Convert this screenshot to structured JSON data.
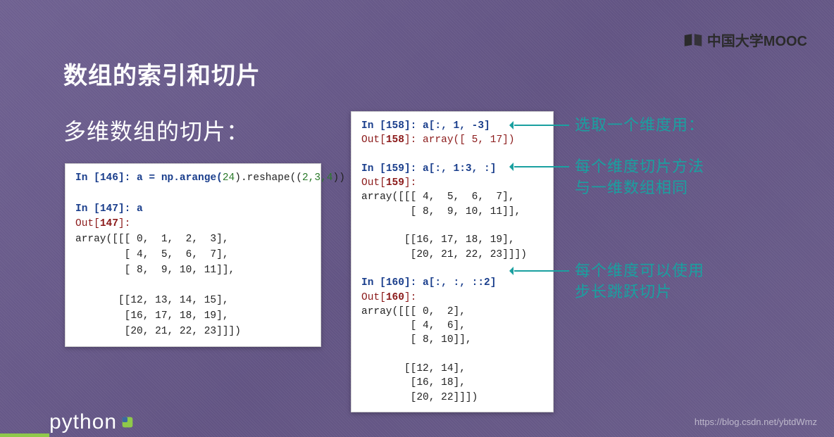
{
  "brand": "中国大学MOOC",
  "heading": "数组的索引和切片",
  "subheading": "多维数组的切片：",
  "annotations": {
    "a1": "选取一个维度用：",
    "a2": "每个维度切片方法\n与一维数组相同",
    "a3": "每个维度可以使用\n步长跳跃切片"
  },
  "left_block": {
    "in146_label": "In [",
    "in146_num": "146",
    "in146_tail": "]: a = np.arange(",
    "in146_arg": "24",
    "in146_tail2": ").reshape((",
    "in146_dims": "2,3,4",
    "in146_tail3": "))",
    "in147_label": "In [",
    "in147_num": "147",
    "in147_tail": "]: a",
    "out147_label": "Out[",
    "out147_num": "147",
    "out147_tail": "]:",
    "array_text": "array([[[ 0,  1,  2,  3],\n        [ 4,  5,  6,  7],\n        [ 8,  9, 10, 11]],\n\n       [[12, 13, 14, 15],\n        [16, 17, 18, 19],\n        [20, 21, 22, 23]]])"
  },
  "right_block": {
    "in158_num": "158",
    "in158_code": "]: a[:, 1, -3]",
    "out158_num": "158",
    "out158_val": "]: array([ 5, 17])",
    "in159_num": "159",
    "in159_code": "]: a[:, 1:3, :]",
    "out159_num": "159",
    "out159_tail": "]:",
    "arr159": "array([[[ 4,  5,  6,  7],\n        [ 8,  9, 10, 11]],\n\n       [[16, 17, 18, 19],\n        [20, 21, 22, 23]]])",
    "in160_num": "160",
    "in160_code": "]: a[:, :, ::2]",
    "out160_num": "160",
    "out160_tail": "]:",
    "arr160": "array([[[ 0,  2],\n        [ 4,  6],\n        [ 8, 10]],\n\n       [[12, 14],\n        [16, 18],\n        [20, 22]]])"
  },
  "footer": {
    "python": "python",
    "watermark": "https://blog.csdn.net/ybtdWmz"
  }
}
